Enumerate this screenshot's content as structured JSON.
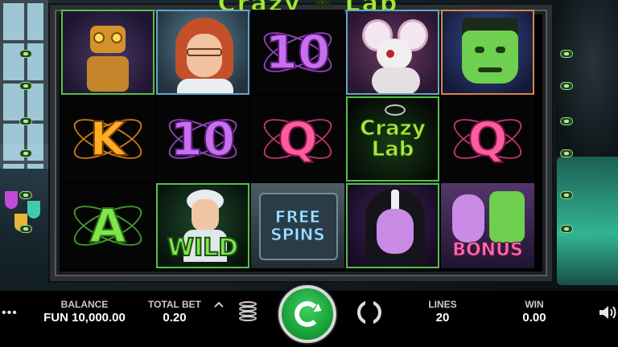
{
  "game": {
    "logo_text": "Crazy ⚛ Lab"
  },
  "reels": {
    "rows": [
      [
        {
          "symbol": "robot",
          "frame": "green"
        },
        {
          "symbol": "scientist-woman",
          "frame": "blue"
        },
        {
          "symbol": "10",
          "color": "purple"
        },
        {
          "symbol": "lab-mouse",
          "frame": "blue"
        },
        {
          "symbol": "frankenstein",
          "frame": "orange"
        }
      ],
      [
        {
          "symbol": "K",
          "color": "orange"
        },
        {
          "symbol": "10",
          "color": "purple"
        },
        {
          "symbol": "Q",
          "color": "pink"
        },
        {
          "symbol": "crazy-lab-logo",
          "frame": "green"
        },
        {
          "symbol": "Q",
          "color": "pink"
        }
      ],
      [
        {
          "symbol": "A",
          "color": "green"
        },
        {
          "symbol": "wild",
          "frame": "green"
        },
        {
          "symbol": "free-spins"
        },
        {
          "symbol": "bride",
          "frame": "green"
        },
        {
          "symbol": "bonus"
        }
      ]
    ],
    "labels": {
      "r1c3": "10",
      "r2c1": "K",
      "r2c2": "10",
      "r2c3": "Q",
      "r2c4_line1": "Crazy",
      "r2c4_line2": "Lab",
      "r2c5": "Q",
      "r3c1": "A",
      "r3c2": "WILD",
      "r3c3_line1": "FREE",
      "r3c3_line2": "SPINS",
      "r3c5": "BONUS"
    }
  },
  "status_bar": {
    "menu_icon": "ellipsis-icon",
    "balance": {
      "label": "BALANCE",
      "value": "FUN 10,000.00"
    },
    "total_bet": {
      "label": "TOTAL BET",
      "value": "0.20"
    },
    "lines": {
      "label": "LINES",
      "value": "20"
    },
    "win": {
      "label": "WIN",
      "value": "0.00"
    },
    "icons": [
      "chevron-up-icon",
      "coin-stack-icon",
      "spin-icon",
      "autoplay-icon",
      "speaker-icon"
    ]
  },
  "colors": {
    "spin_button": "#1fae40",
    "reel_frame_green": "#56c04a",
    "bar_bg": "#000000",
    "logo_green": "#a4e83a"
  }
}
